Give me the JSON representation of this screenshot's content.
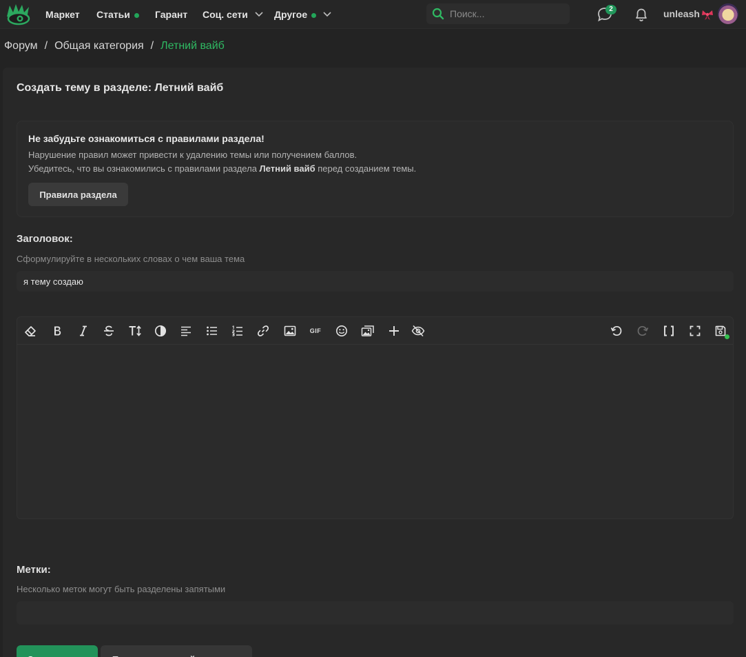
{
  "nav": {
    "logo_icon": "eye-crown-logo-icon",
    "items": [
      {
        "label": "Маркет"
      },
      {
        "label": "Статьи"
      },
      {
        "label": "Гарант"
      },
      {
        "label": "Соц. сети"
      },
      {
        "label": "Другое"
      }
    ],
    "search_placeholder": "Поиск...",
    "messages_badge": "2",
    "username": "unleash",
    "accent_color": "#2fba63"
  },
  "breadcrumb": {
    "items": [
      "Форум",
      "Общая категория"
    ],
    "current": "Летний вайб",
    "separator": "/"
  },
  "page": {
    "title": "Создать тему в разделе: Летний вайб"
  },
  "notice": {
    "title": "Не забудьте ознакомиться с правилами раздела!",
    "line1": "Нарушение правил может привести к удалению темы или получением баллов.",
    "line2_before": "Убедитесь, что вы ознакомились с правилами раздела ",
    "line2_bold": "Летний вайб",
    "line2_after": " перед созданием темы.",
    "button": "Правила раздела"
  },
  "title_field": {
    "label": "Заголовок:",
    "hint": "Сформулируйте в нескольких словах о чем ваша тема",
    "value": "я тему создаю"
  },
  "editor": {
    "toolbar": [
      "eraser-icon",
      "bold-icon",
      "italic-icon",
      "strikethrough-icon",
      "text-size-icon",
      "color-contrast-icon",
      "align-left-icon",
      "bullet-list-icon",
      "numbered-list-icon",
      "link-icon",
      "image-icon",
      "gif-icon",
      "emoji-icon",
      "media-icon",
      "plus-icon",
      "hide-eye-icon",
      "undo-icon",
      "redo-icon",
      "bbcode-brackets-icon",
      "fullscreen-icon",
      "save-draft-icon"
    ],
    "gif_label": "GIF"
  },
  "tags_field": {
    "label": "Метки:",
    "hint": "Несколько меток могут быть разделены запятыми",
    "value": ""
  },
  "buttons": {
    "create": "Создать тему",
    "preview": "Предварительный просмотр"
  }
}
